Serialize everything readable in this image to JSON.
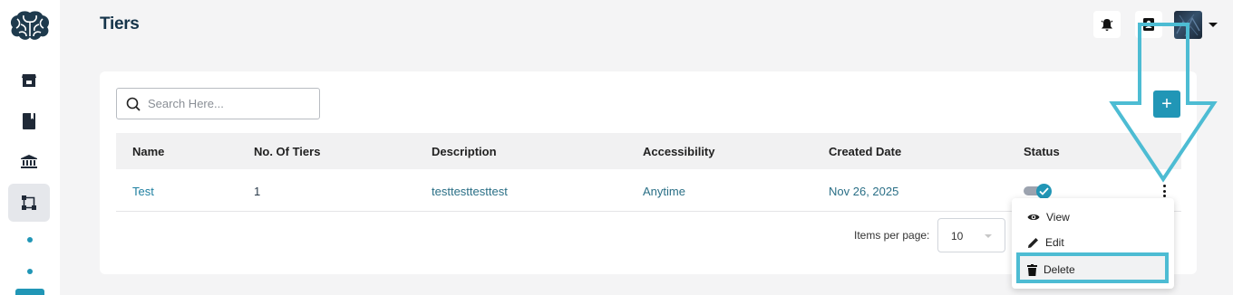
{
  "header": {
    "title": "Tiers"
  },
  "search": {
    "placeholder": "Search Here..."
  },
  "add_button": {
    "label": "+"
  },
  "table": {
    "columns": [
      "Name",
      "No. Of Tiers",
      "Description",
      "Accessibility",
      "Created Date",
      "Status"
    ],
    "rows": [
      {
        "name": "Test",
        "tiers": "1",
        "description": "testtesttesttest",
        "accessibility": "Anytime",
        "created_date": "Nov 26, 2025",
        "status_enabled": true
      }
    ]
  },
  "pagination": {
    "items_per_page_label": "Items per page:",
    "items_per_page_value": "10"
  },
  "row_menu": {
    "items": [
      {
        "label": "View",
        "icon": "eye-icon"
      },
      {
        "label": "Edit",
        "icon": "pencil-icon"
      },
      {
        "label": "Delete",
        "icon": "trash-icon"
      }
    ]
  },
  "colors": {
    "accent": "#2196b6",
    "title": "#15344a",
    "annotation": "#4dbcd3"
  }
}
